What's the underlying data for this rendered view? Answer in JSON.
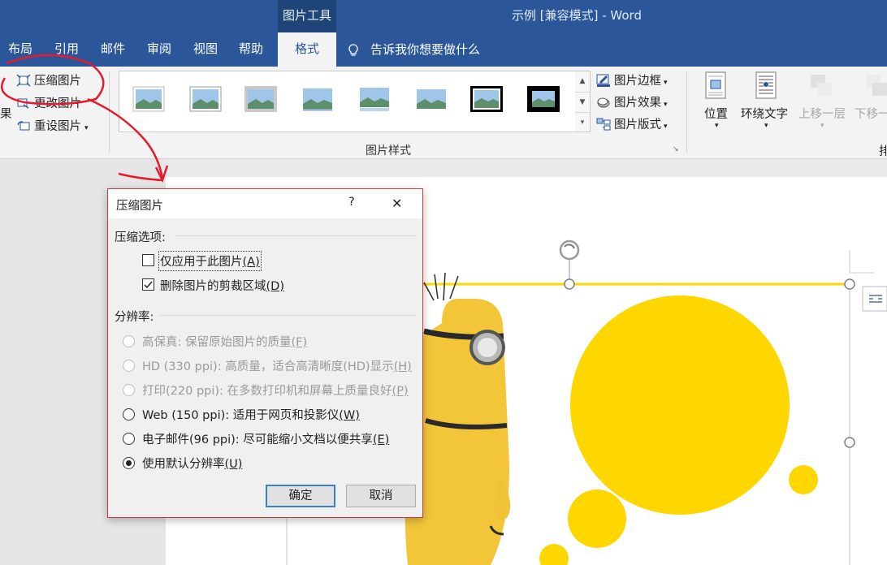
{
  "window": {
    "contextual_group": "图片工具",
    "title": "示例 [兼容模式]  -  Word"
  },
  "tabs": [
    {
      "label": "布局"
    },
    {
      "label": "引用"
    },
    {
      "label": "邮件"
    },
    {
      "label": "审阅"
    },
    {
      "label": "视图"
    },
    {
      "label": "帮助"
    },
    {
      "label": "格式",
      "active": true
    }
  ],
  "tell_me": "告诉我你想要做什么",
  "ribbon": {
    "adjust": {
      "partial": "果",
      "compress": "压缩图片",
      "change": "更改图片",
      "reset": "重设图片"
    },
    "styles_group_label": "图片样式",
    "border": "图片边框",
    "effects": "图片效果",
    "layout": "图片版式",
    "position": "位置",
    "wrap_text": "环绕文字",
    "bring_forward": "上移一层",
    "send_backward": "下移一",
    "arrange_partial": "排"
  },
  "dialog": {
    "title": "压缩图片",
    "help": "?",
    "close": "✕",
    "compress_section": "压缩选项:",
    "options": [
      {
        "label": "仅应用于此图片",
        "key": "(A)",
        "checked": false
      },
      {
        "label": "删除图片的剪裁区域",
        "key": "(D)",
        "checked": true
      }
    ],
    "resolution_section": "分辨率:",
    "resolutions": [
      {
        "label": "高保真: 保留原始图片的质量",
        "key": "(F)",
        "enabled": false,
        "selected": false
      },
      {
        "label": "HD (330 ppi): 高质量，适合高清晰度(HD)显示",
        "key": "(H)",
        "enabled": false,
        "selected": false
      },
      {
        "label": "打印(220 ppi): 在多数打印机和屏幕上质量良好",
        "key": "(P)",
        "enabled": false,
        "selected": false
      },
      {
        "label": "Web (150 ppi): 适用于网页和投影仪",
        "key": "(W)",
        "enabled": true,
        "selected": false
      },
      {
        "label": "电子邮件(96 ppi): 尽可能缩小文档以便共享",
        "key": "(E)",
        "enabled": true,
        "selected": false
      },
      {
        "label": "使用默认分辨率",
        "key": "(U)",
        "enabled": true,
        "selected": true
      }
    ],
    "ok": "确定",
    "cancel": "取消"
  },
  "colors": {
    "word_blue": "#2b579a",
    "shape_yellow": "#fed700",
    "annotation_red": "#e8192c"
  }
}
